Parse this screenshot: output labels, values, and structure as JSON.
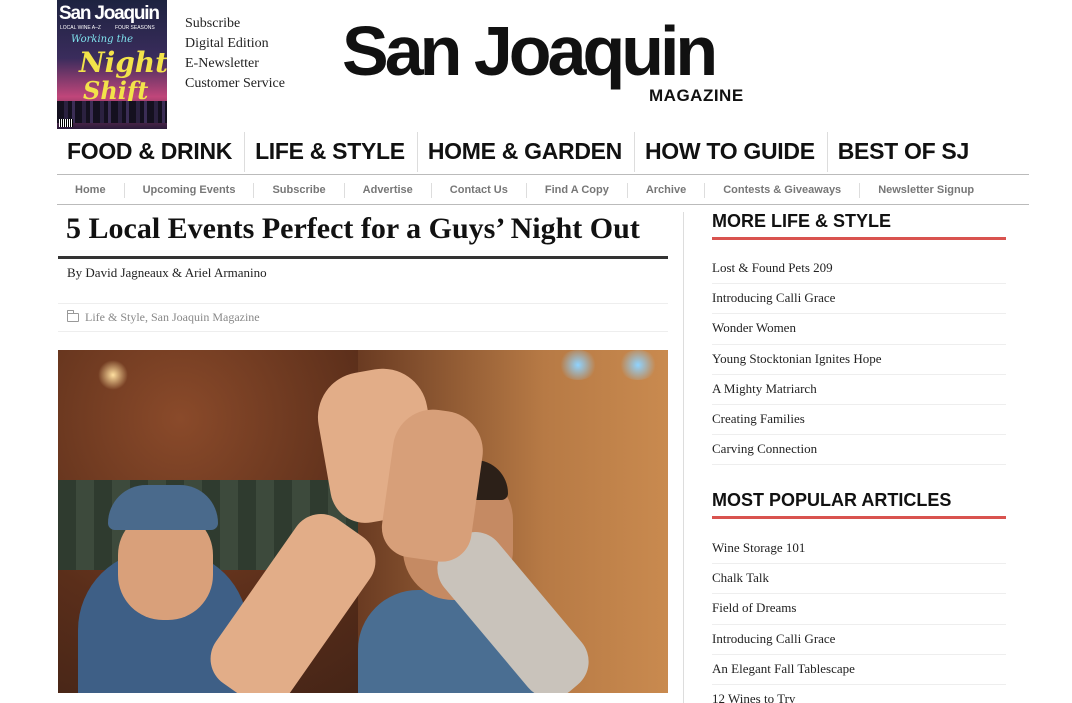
{
  "cover": {
    "title": "San Joaquin",
    "line_left": "LOCAL WINE A–Z",
    "line_right": "FOUR SEASONS",
    "script": "Working the",
    "night": "Night",
    "shift": "Shift"
  },
  "top_links": [
    "Subscribe",
    "Digital Edition",
    "E-Newsletter",
    "Customer Service"
  ],
  "logo": {
    "main": "San Joaquin",
    "sub": "MAGAZINE"
  },
  "main_nav": [
    "FOOD & DRINK",
    "LIFE & STYLE",
    "HOME & GARDEN",
    "HOW TO GUIDE",
    "BEST OF SJ"
  ],
  "sub_nav": [
    "Home",
    "Upcoming Events",
    "Subscribe",
    "Advertise",
    "Contact Us",
    "Find A Copy",
    "Archive",
    "Contests & Giveaways",
    "Newsletter Signup"
  ],
  "article": {
    "title": "5 Local Events Perfect for a Guys’ Night Out",
    "byline": "By David Jagneaux & Ariel Armanino",
    "categories": "Life & Style, San Joaquin Magazine"
  },
  "sidebar": {
    "more_heading": "MORE LIFE & STYLE",
    "more_items": [
      "Lost & Found Pets 209",
      "Introducing Calli Grace",
      "Wonder Women",
      "Young Stocktonian Ignites Hope",
      "A Mighty Matriarch",
      "Creating Families",
      "Carving Connection"
    ],
    "popular_heading": "MOST POPULAR ARTICLES",
    "popular_items": [
      "Wine Storage 101",
      "Chalk Talk",
      "Field of Dreams",
      "Introducing Calli Grace",
      "An Elegant Fall Tablescape",
      "12 Wines to Try"
    ]
  },
  "colors": {
    "accent": "#d9534f",
    "text": "#222222",
    "muted": "#888888"
  }
}
